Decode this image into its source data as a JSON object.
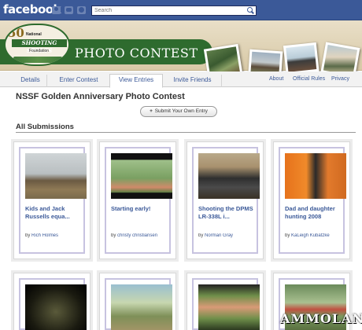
{
  "fb_bar": {
    "logo": "facebook",
    "search_placeholder": "Search",
    "icons": [
      "friend-requests-icon",
      "messages-icon",
      "notifications-globe-icon"
    ],
    "bar_color": "#3b5998"
  },
  "banner": {
    "seal_number": "50",
    "seal_line1": "National",
    "seal_line2": "SHOOTING SPORTS",
    "seal_line3": "Foundation",
    "title": "PHOTO CONTEST",
    "accent_color": "#2e6b2e"
  },
  "tabs": {
    "items": [
      {
        "label": "Details"
      },
      {
        "label": "Enter Contest"
      },
      {
        "label": "View Entries",
        "active": true
      },
      {
        "label": "Invite Friends"
      }
    ],
    "right_links": [
      {
        "label": "About"
      },
      {
        "label": "Official Rules"
      },
      {
        "label": "Privacy"
      }
    ]
  },
  "main": {
    "title": "NSSF Golden Anniversary Photo Contest",
    "submit_button": "Submit Your Own Entry",
    "section_title": "All Submissions"
  },
  "entries": [
    {
      "caption": "Kids and Jack Russells equa...",
      "by": "by",
      "author": "Rich Holmes"
    },
    {
      "caption": "Starting early!",
      "by": "by",
      "author": "christy christiansen"
    },
    {
      "caption": "Shooting the DPMS LR-338L i...",
      "by": "by",
      "author": "Norman Gray"
    },
    {
      "caption": "Dad and daughter hunting 2008",
      "by": "by",
      "author": "KaLeigh Kubatzke"
    },
    {
      "caption": "",
      "by": "",
      "author": ""
    },
    {
      "caption": "",
      "by": "",
      "author": ""
    },
    {
      "caption": "",
      "by": "",
      "author": ""
    },
    {
      "caption": "",
      "by": "",
      "author": ""
    }
  ],
  "watermark": "AMMOLAND"
}
